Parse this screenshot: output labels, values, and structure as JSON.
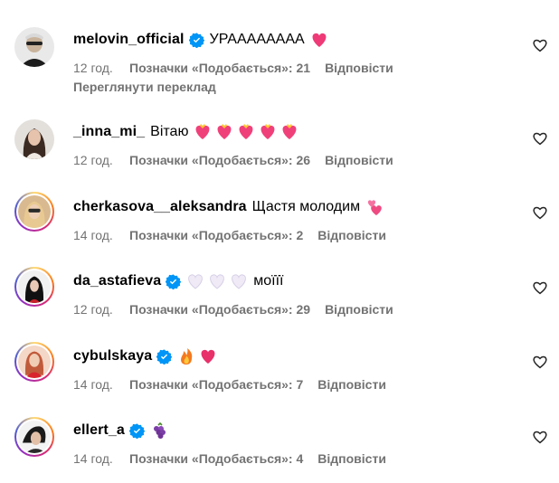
{
  "icons": {
    "verified": "verified-badge-icon",
    "like": "heart-outline-icon"
  },
  "colors": {
    "verified_blue": "#0095f6",
    "meta_gray": "#737373",
    "heart_pink": "#e8306a"
  },
  "comments": [
    {
      "username": "melovin_official",
      "verified": true,
      "text": "УРАААААААА",
      "time": "12 год.",
      "likes_label": "Позначки «Подобається»: 21",
      "reply_label": "Відповісти",
      "translate_label": "Переглянути переклад"
    },
    {
      "username": "_inna_mi_",
      "verified": false,
      "text": "Вітаю",
      "time": "12 год.",
      "likes_label": "Позначки «Подобається»: 26",
      "reply_label": "Відповісти"
    },
    {
      "username": "cherkasova__aleksandra",
      "verified": false,
      "text": "Щастя молодим",
      "time": "14 год.",
      "likes_label": "Позначки «Подобається»: 2",
      "reply_label": "Відповісти"
    },
    {
      "username": "da_astafieva",
      "verified": true,
      "text": "моїїї",
      "time": "12 год.",
      "likes_label": "Позначки «Подобається»: 29",
      "reply_label": "Відповісти"
    },
    {
      "username": "cybulskaya",
      "verified": true,
      "text": "",
      "time": "14 год.",
      "likes_label": "Позначки «Подобається»: 7",
      "reply_label": "Відповісти"
    },
    {
      "username": "ellert_a",
      "verified": true,
      "text": "",
      "time": "14 год.",
      "likes_label": "Позначки «Подобається»: 4",
      "reply_label": "Відповісти"
    }
  ]
}
